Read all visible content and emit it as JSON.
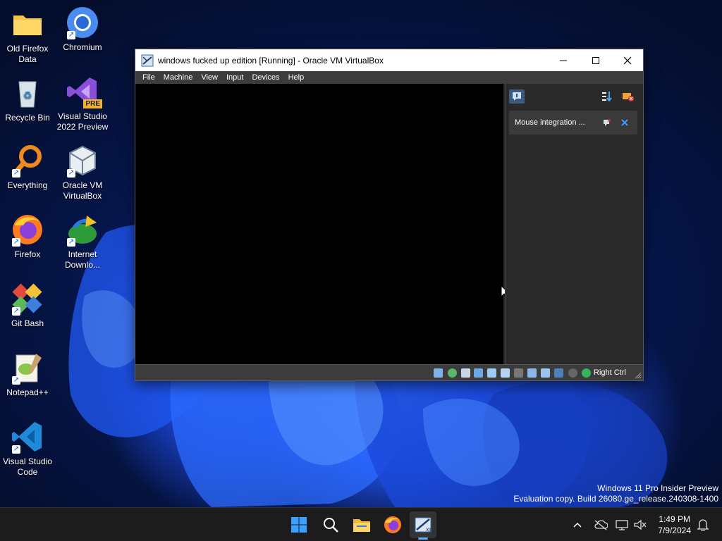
{
  "desktop": {
    "icons": [
      {
        "label": "Old Firefox Data"
      },
      {
        "label": "Chromium"
      },
      {
        "label": "Recycle Bin"
      },
      {
        "label": "Visual Studio 2022 Preview",
        "badge": "PRE"
      },
      {
        "label": "Everything"
      },
      {
        "label": "Oracle VM VirtualBox"
      },
      {
        "label": "Firefox"
      },
      {
        "label": "Internet Downlo..."
      },
      {
        "label": "Git Bash"
      },
      {
        "label": "Notepad++"
      },
      {
        "label": "Visual Studio Code"
      }
    ]
  },
  "window": {
    "title": "windows fucked up edition [Running] - Oracle VM VirtualBox",
    "menu": [
      "File",
      "Machine",
      "View",
      "Input",
      "Devices",
      "Help"
    ],
    "notification": "Mouse integration ...",
    "host_key": "Right Ctrl"
  },
  "watermark": {
    "line1": "Windows 11 Pro Insider Preview",
    "line2": "Evaluation copy. Build 26080.ge_release.240308-1400"
  },
  "taskbar": {
    "time": "1:49 PM",
    "date": "7/9/2024"
  },
  "colors": {
    "accent": "#0a5fd8",
    "taskbar": "#1c1c1c",
    "vm_screen": "#000000"
  }
}
